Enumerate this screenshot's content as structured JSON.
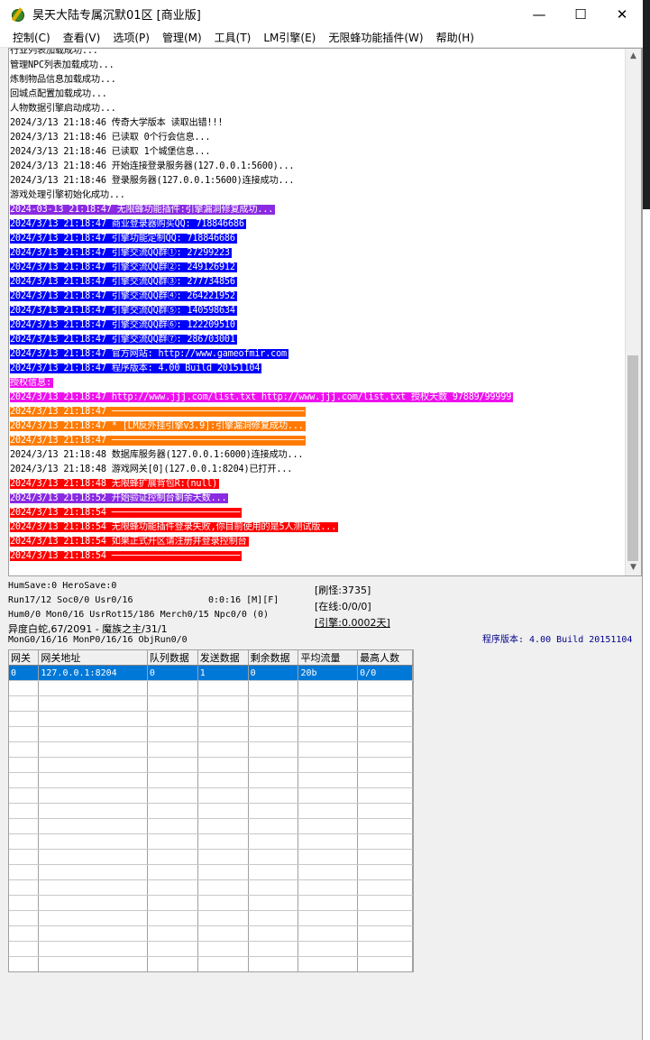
{
  "window": {
    "title": "昊天大陆专属沉默01区 [商业版]",
    "controls": {
      "minimize": "—",
      "maximize": "☐",
      "close": "✕"
    }
  },
  "menu": [
    "控制(C)",
    "查看(V)",
    "选项(P)",
    "管理(M)",
    "工具(T)",
    "LM引擎(E)",
    "无限蜂功能插件(W)",
    "帮助(H)"
  ],
  "log": [
    {
      "text": "行业列表加载成功...",
      "style": "none"
    },
    {
      "text": "管理NPC列表加载成功...",
      "style": "none"
    },
    {
      "text": "炼制物品信息加载成功...",
      "style": "none"
    },
    {
      "text": "回城点配置加载成功...",
      "style": "none"
    },
    {
      "text": "人物数据引擎启动成功...",
      "style": "none"
    },
    {
      "text": "2024/3/13 21:18:46 传奇大学版本 读取出错!!!",
      "style": "none"
    },
    {
      "text": "2024/3/13 21:18:46 已读取 0个行会信息...",
      "style": "none"
    },
    {
      "text": "2024/3/13 21:18:46 已读取 1个城堡信息...",
      "style": "none"
    },
    {
      "text": "2024/3/13 21:18:46 开始连接登录服务器(127.0.0.1:5600)...",
      "style": "none"
    },
    {
      "text": "2024/3/13 21:18:46 登录服务器(127.0.0.1:5600)连接成功...",
      "style": "none"
    },
    {
      "text": "游戏处理引擎初始化成功...",
      "style": "none"
    },
    {
      "text": "2024-03-13 21:18:47 无限蜂功能插件:引擎漏洞修复成功...",
      "style": "purple"
    },
    {
      "text": "2024/3/13 21:18:47 商业登录器购买QQ: 718846686",
      "style": "blue"
    },
    {
      "text": "2024/3/13 21:18:47 引擎功能定制QQ: 718846686",
      "style": "blue"
    },
    {
      "text": "2024/3/13 21:18:47 引擎交流QQ群①: 27299223",
      "style": "blue"
    },
    {
      "text": "2024/3/13 21:18:47 引擎交流QQ群②: 249126912",
      "style": "blue"
    },
    {
      "text": "2024/3/13 21:18:47 引擎交流QQ群③: 277734856",
      "style": "blue"
    },
    {
      "text": "2024/3/13 21:18:47 引擎交流QQ群④: 264221952",
      "style": "blue"
    },
    {
      "text": "2024/3/13 21:18:47 引擎交流QQ群⑤: 140598634",
      "style": "blue"
    },
    {
      "text": "2024/3/13 21:18:47 引擎交流QQ群⑥: 122209510",
      "style": "blue"
    },
    {
      "text": "2024/3/13 21:18:47 引擎交流QQ群⑦: 286703001",
      "style": "blue"
    },
    {
      "text": "2024/3/13 21:18:47 官方网站: http://www.gameofmir.com",
      "style": "blue"
    },
    {
      "text": "2024/3/13 21:18:47 程序版本: 4.00 Build 20151104",
      "style": "blue"
    },
    {
      "text": "授权信息:",
      "style": "magenta"
    },
    {
      "text": "2024/3/13 21:18:47 http://www.jjj.com/list.txt http://www.jjj.com/list.txt 授权天数 97889/99999",
      "style": "magenta"
    },
    {
      "text": "2024/3/13 21:18:47 ────────────────────────────────────",
      "style": "orange"
    },
    {
      "text": "2024/3/13 21:18:47 * [LM反外挂引擎v3.9]:引擎漏洞修复成功...",
      "style": "orange"
    },
    {
      "text": "2024/3/13 21:18:47 ────────────────────────────────────",
      "style": "orange"
    },
    {
      "text": "2024/3/13 21:18:48 数据库服务器(127.0.0.1:6000)连接成功...",
      "style": "none"
    },
    {
      "text": "2024/3/13 21:18:48 游戏网关[0](127.0.0.1:8204)已打开...",
      "style": "none"
    },
    {
      "text": "2024/3/13 21:18:48 无限蜂扩展背包R:(null)",
      "style": "red"
    },
    {
      "text": "2024/3/13 21:18:52 开始验证控制台剩余天数...",
      "style": "purple"
    },
    {
      "text": "2024/3/13 21:18:54 ────────────────────────",
      "style": "red"
    },
    {
      "text": "2024/3/13 21:18:54 无限蜂功能插件登录失败,你目前使用的是5人测试版...",
      "style": "red"
    },
    {
      "text": "2024/3/13 21:18:54 如果正式开区请注册并登录控制台",
      "style": "red"
    },
    {
      "text": "2024/3/13 21:18:54 ────────────────────────",
      "style": "red"
    }
  ],
  "status": {
    "line1": "HumSave:0 HeroSave:0",
    "line2": "Run17/12 Soc0/0 Usr0/16",
    "time": "0:0:16 [M][F]",
    "line3": "Hum0/0 Mon0/16 UsrRot15/186 Merch0/15 Npc0/0 (0)",
    "line4": "异度白蛇,67/2091 - 魔族之主/31/1",
    "line5": "MonG0/16/16 MonP0/16/16 ObjRun0/0",
    "refresh": "[刷怪:3735]",
    "online": "[在线:0/0/0]",
    "engine": "[引擎:0.0002天]",
    "version": "程序版本: 4.00 Build 20151104"
  },
  "grid": {
    "headers": [
      "网关",
      "网关地址",
      "队列数据",
      "发送数据",
      "剩余数据",
      "平均流量",
      "最高人数"
    ],
    "rows": [
      [
        "0",
        "127.0.0.1:8204",
        "0",
        "1",
        "0",
        "20b",
        "0/0"
      ]
    ],
    "empty_rows": 19
  }
}
